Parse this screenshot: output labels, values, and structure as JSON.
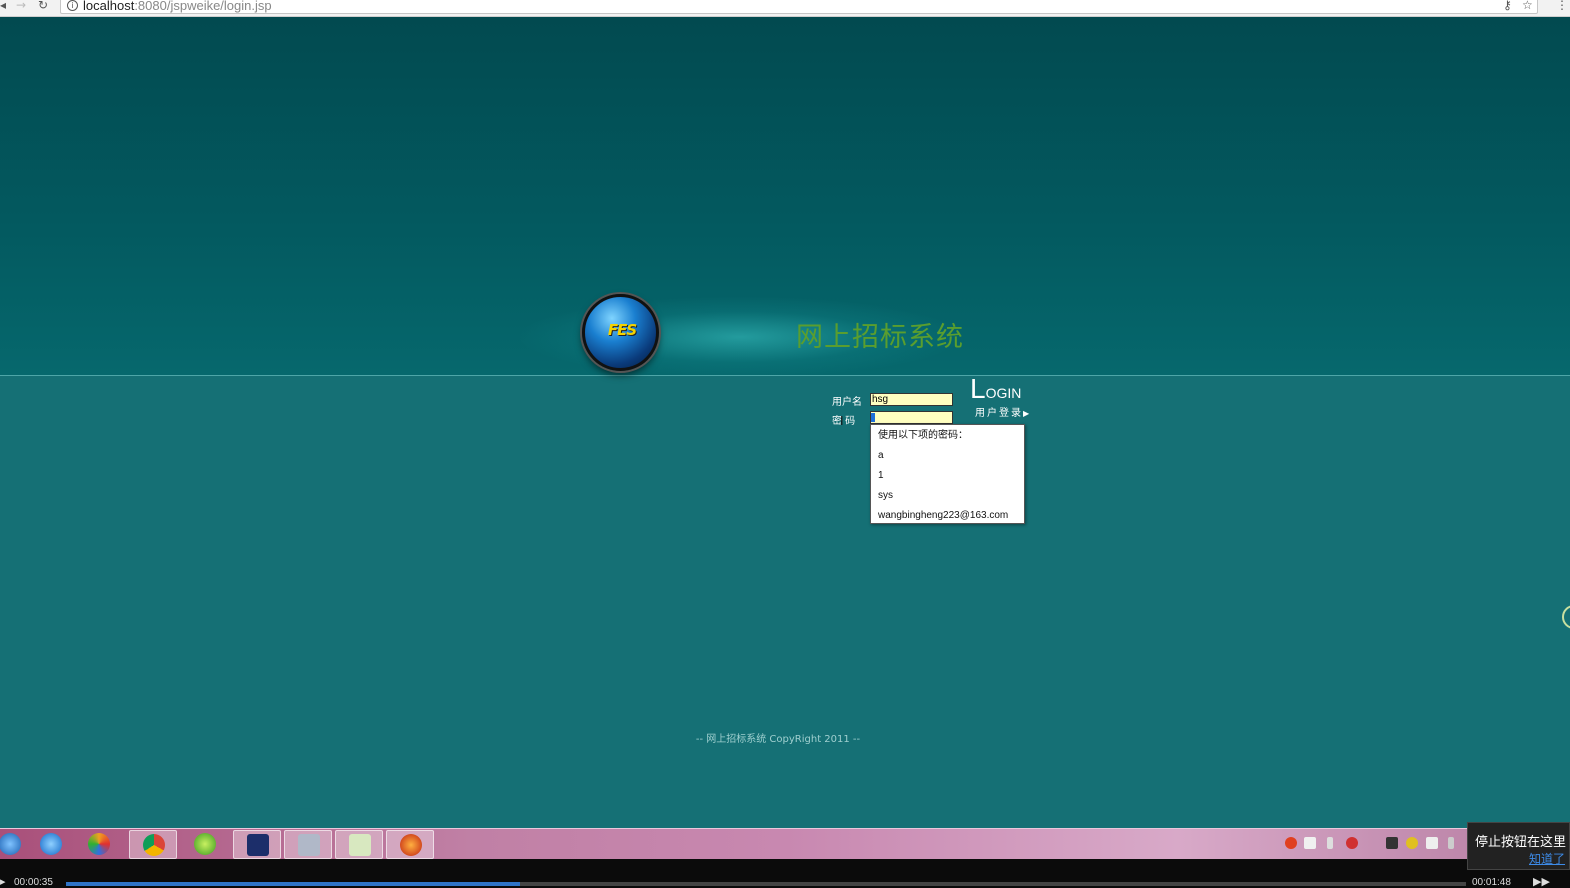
{
  "browser": {
    "url_host": "localhost",
    "url_path": ":8080/jspweike/login.jsp"
  },
  "page": {
    "system_title": "网上招标系统",
    "logo_text": "FES",
    "login_heading_initial": "L",
    "login_heading_rest": "OGIN",
    "login_subtitle": "用户登录",
    "username_label": "用户名",
    "password_label": "密 码",
    "username_value": "hsg",
    "copyright": "-- 网上招标系统 CopyRight 2011 --"
  },
  "autofill": {
    "header": "使用以下项的密码：",
    "options": [
      "a",
      "1",
      "sys",
      "wangbingheng223@163.com"
    ]
  },
  "taskbar": {
    "icons": [
      "windows-start-icon",
      "ie-icon",
      "media-icon",
      "chrome-icon",
      "green-app-icon",
      "eclipse-icon",
      "tool-icon",
      "notepad-icon",
      "recorder-icon"
    ]
  },
  "player": {
    "current_time": "00:00:35",
    "total_time": "00:01:48",
    "progress": 0.324
  },
  "tooltip": {
    "text": "停止按钮在这里",
    "link": "知道了"
  },
  "colors": {
    "page_bg": "#157075",
    "title_green": "#5a9e2e",
    "input_bg": "#ffffc0",
    "progress": "#2f74c8"
  }
}
